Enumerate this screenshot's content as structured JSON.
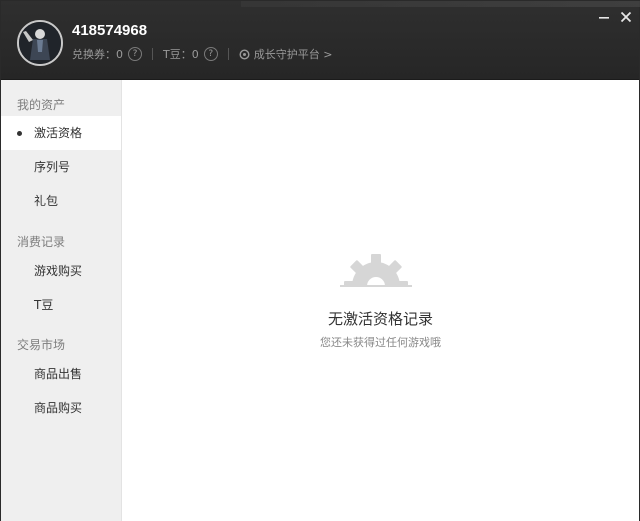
{
  "header": {
    "username": "418574968",
    "coupon_label": "兑换券：0",
    "tdou_label": "T豆：0",
    "help_glyph": "?",
    "growth_label": "成长守护平台 >"
  },
  "sidebar": {
    "groups": [
      {
        "title": "我的资产",
        "items": [
          {
            "label": "激活资格",
            "active": true
          },
          {
            "label": "序列号"
          },
          {
            "label": "礼包"
          }
        ]
      },
      {
        "title": "消费记录",
        "items": [
          {
            "label": "游戏购买"
          },
          {
            "label": "T豆"
          }
        ]
      },
      {
        "title": "交易市场",
        "items": [
          {
            "label": "商品出售"
          },
          {
            "label": "商品购买"
          }
        ]
      }
    ]
  },
  "main": {
    "empty_icon": "gear-icon",
    "empty_title": "无激活资格记录",
    "empty_subtitle": "您还未获得过任何游戏哦"
  },
  "colors": {
    "header_bg": "#2b2b2b",
    "sidebar_bg": "#efefef",
    "active_item_bg": "#ffffff",
    "empty_icon": "#d6d6d6"
  }
}
